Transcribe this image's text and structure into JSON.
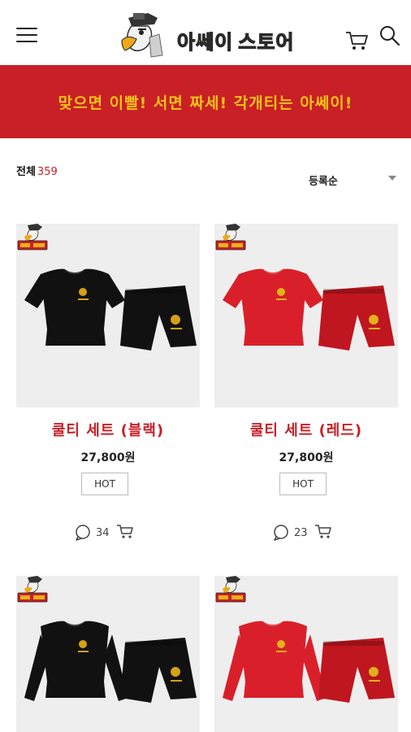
{
  "header": {
    "logo_text_part1": "아쎄이",
    "logo_text_part2": "스토어",
    "menu_icon": "hamburger-menu-icon",
    "cart_icon": "cart-icon",
    "search_icon": "search-icon"
  },
  "banner": {
    "text": "맞으면 이빨! 서면 짜세! 각개티는 아쎄이!",
    "background": "#c91f26",
    "text_color": "#f4c218"
  },
  "list": {
    "total_label": "전체",
    "total_count": "359",
    "sort_label": "등록순"
  },
  "products": [
    {
      "title": "쿨티 세트 (블랙)",
      "price": "27,800원",
      "tag": "HOT",
      "comments": "34",
      "shirt_color": "#111111",
      "shorts_color": "#111111",
      "print_color": "#d4a017"
    },
    {
      "title": "쿨티 세트 (레드)",
      "price": "27,800원",
      "tag": "HOT",
      "comments": "23",
      "shirt_color": "#d9202a",
      "shorts_color": "#c0161f",
      "print_color": "#e0b21b"
    },
    {
      "title": "",
      "price": "",
      "tag": "",
      "comments": "",
      "shirt_color": "#111111",
      "shorts_color": "#111111",
      "print_color": "#d4a017",
      "long_sleeve": true
    },
    {
      "title": "",
      "price": "",
      "tag": "",
      "comments": "",
      "shirt_color": "#d9202a",
      "shorts_color": "#c0161f",
      "print_color": "#e0b21b",
      "long_sleeve": true
    }
  ]
}
